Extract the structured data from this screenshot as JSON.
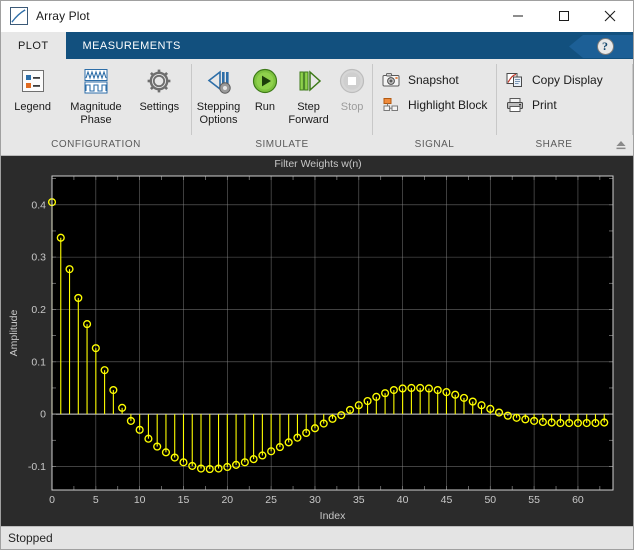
{
  "window": {
    "title": "Array Plot",
    "icon": "array-plot-icon",
    "minimize_label": "Minimize",
    "maximize_label": "Maximize",
    "close_label": "Close"
  },
  "tabs": [
    {
      "label": "PLOT",
      "active": true
    },
    {
      "label": "MEASUREMENTS",
      "active": false
    }
  ],
  "help": {
    "glyph": "?",
    "label": "Help"
  },
  "ribbon": {
    "groups": [
      {
        "label": "CONFIGURATION",
        "buttons": [
          {
            "name": "legend-button",
            "label": "Legend",
            "icon": "legend-icon",
            "enabled": true
          },
          {
            "name": "magnitude-phase-button",
            "label": "Magnitude\nPhase",
            "icon": "magnitude-phase-icon",
            "enabled": true
          },
          {
            "name": "settings-button",
            "label": "Settings",
            "icon": "gear-icon",
            "enabled": true
          }
        ]
      },
      {
        "label": "SIMULATE",
        "buttons": [
          {
            "name": "stepping-options-button",
            "label": "Stepping\nOptions",
            "icon": "stepping-options-icon",
            "enabled": true
          },
          {
            "name": "run-button",
            "label": "Run",
            "icon": "run-icon",
            "enabled": true
          },
          {
            "name": "step-forward-button",
            "label": "Step\nForward",
            "icon": "step-forward-icon",
            "enabled": true
          },
          {
            "name": "stop-button",
            "label": "Stop",
            "icon": "stop-icon",
            "enabled": false
          }
        ]
      },
      {
        "label": "SIGNAL",
        "small_buttons": [
          {
            "name": "snapshot-button",
            "label": "Snapshot",
            "icon": "camera-icon"
          },
          {
            "name": "highlight-block-button",
            "label": "Highlight Block",
            "icon": "highlight-block-icon"
          }
        ]
      },
      {
        "label": "SHARE",
        "small_buttons": [
          {
            "name": "copy-display-button",
            "label": "Copy Display",
            "icon": "copy-display-icon"
          },
          {
            "name": "print-button",
            "label": "Print",
            "icon": "printer-icon"
          }
        ]
      }
    ],
    "collapse_label": "Minimize Ribbon"
  },
  "statusbar": {
    "text": "Stopped"
  },
  "colors": {
    "accent": "#12507e",
    "tab_active_bg": "#e7e7e7",
    "ribbon_bg": "#e7e7e7",
    "plot_figure_bg": "#2b2b2b",
    "plot_axes_bg": "#000000",
    "plot_grid": "#8c8c8c",
    "plot_text": "#c8c8c8",
    "series_color": "#ffff00",
    "statusbar_bg": "#e4e4e4"
  },
  "chart_data": {
    "type": "line",
    "plot_style": "stem",
    "title": "Filter Weights w(n)",
    "xlabel": "Index",
    "ylabel": "Amplitude",
    "xlim": [
      0,
      64
    ],
    "ylim": [
      -0.145,
      0.455
    ],
    "xticks": [
      0,
      5,
      10,
      15,
      20,
      25,
      30,
      35,
      40,
      45,
      50,
      55,
      60
    ],
    "xticklabels": [
      "0",
      "5",
      "10",
      "15",
      "20",
      "25",
      "30",
      "35",
      "40",
      "45",
      "50",
      "55",
      "60"
    ],
    "yticks": [
      -0.1,
      0,
      0.1,
      0.2,
      0.3,
      0.4
    ],
    "yticklabels": [
      "-0.1",
      "0",
      "0.1",
      "0.2",
      "0.3",
      "0.4"
    ],
    "grid": true,
    "legend": false,
    "marker": "circle-open",
    "series": [
      {
        "name": "w(n)",
        "color": "#ffff00",
        "x": [
          0,
          1,
          2,
          3,
          4,
          5,
          6,
          7,
          8,
          9,
          10,
          11,
          12,
          13,
          14,
          15,
          16,
          17,
          18,
          19,
          20,
          21,
          22,
          23,
          24,
          25,
          26,
          27,
          28,
          29,
          30,
          31,
          32,
          33,
          34,
          35,
          36,
          37,
          38,
          39,
          40,
          41,
          42,
          43,
          44,
          45,
          46,
          47,
          48,
          49,
          50,
          51,
          52,
          53,
          54,
          55,
          56,
          57,
          58,
          59,
          60,
          61,
          62,
          63
        ],
        "values": [
          0.405,
          0.337,
          0.277,
          0.222,
          0.172,
          0.126,
          0.084,
          0.046,
          0.012,
          -0.013,
          -0.03,
          -0.047,
          -0.062,
          -0.073,
          -0.083,
          -0.092,
          -0.099,
          -0.104,
          -0.105,
          -0.104,
          -0.101,
          -0.097,
          -0.092,
          -0.086,
          -0.079,
          -0.071,
          -0.063,
          -0.054,
          -0.045,
          -0.036,
          -0.027,
          -0.018,
          -0.009,
          -0.002,
          0.008,
          0.017,
          0.025,
          0.033,
          0.04,
          0.046,
          0.049,
          0.05,
          0.05,
          0.049,
          0.046,
          0.042,
          0.037,
          0.031,
          0.024,
          0.017,
          0.01,
          0.003,
          -0.003,
          -0.007,
          -0.01,
          -0.013,
          -0.015,
          -0.016,
          -0.017,
          -0.017,
          -0.017,
          -0.017,
          -0.017,
          -0.016
        ]
      }
    ]
  }
}
